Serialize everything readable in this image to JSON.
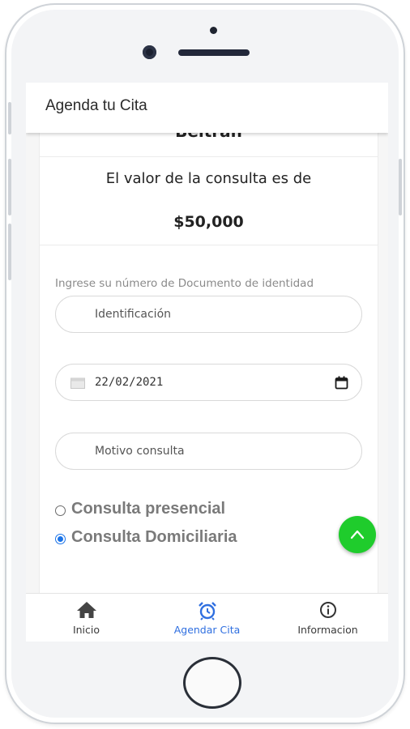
{
  "header": {
    "title": "Agenda tu Cita"
  },
  "card": {
    "cut_name": "Beltran",
    "price_text": "El valor de la consulta es de",
    "price_value": "$50,000"
  },
  "form": {
    "doc_label": "Ingrese su número de Documento de identidad",
    "id_placeholder": "Identificación",
    "date_value": "22/02/2021",
    "reason_placeholder": "Motivo consulta",
    "options": [
      {
        "label": "Consulta presencial",
        "checked": false
      },
      {
        "label": "Consulta Domiciliaria",
        "checked": true
      }
    ]
  },
  "nav": {
    "items": [
      {
        "label": "Inicio",
        "icon": "home-icon",
        "active": false
      },
      {
        "label": "Agendar Cita",
        "icon": "alarm-clock-icon",
        "active": true
      },
      {
        "label": "Informacion",
        "icon": "info-icon",
        "active": false
      }
    ]
  },
  "colors": {
    "accent": "#2f6fe0",
    "fab": "#1fcc2c",
    "radio_checked": "#1a73e8"
  }
}
